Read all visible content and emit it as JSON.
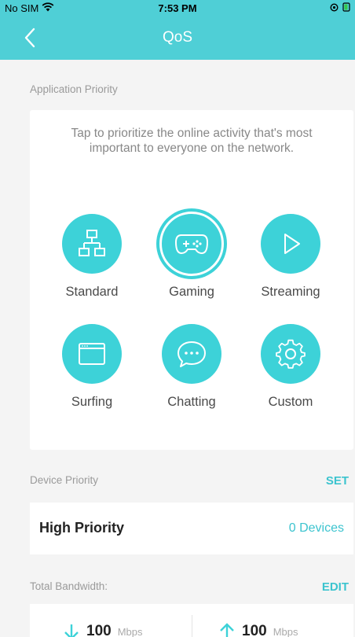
{
  "status_bar": {
    "carrier": "No SIM",
    "time": "7:53 PM"
  },
  "nav": {
    "title": "QoS"
  },
  "application_priority": {
    "section_label": "Application Priority",
    "description": "Tap to prioritize the online activity that's most important to everyone on the network.",
    "modes": [
      {
        "label": "Standard",
        "icon": "network-topology-icon",
        "selected": false
      },
      {
        "label": "Gaming",
        "icon": "gamepad-icon",
        "selected": true
      },
      {
        "label": "Streaming",
        "icon": "play-icon",
        "selected": false
      },
      {
        "label": "Surfing",
        "icon": "browser-window-icon",
        "selected": false
      },
      {
        "label": "Chatting",
        "icon": "chat-bubble-icon",
        "selected": false
      },
      {
        "label": "Custom",
        "icon": "gear-icon",
        "selected": false
      }
    ]
  },
  "device_priority": {
    "section_label": "Device Priority",
    "action_label": "SET",
    "row_title": "High Priority",
    "row_value": "0 Devices"
  },
  "total_bandwidth": {
    "section_label": "Total Bandwidth:",
    "action_label": "EDIT",
    "download": {
      "value": "100",
      "unit": "Mbps",
      "icon": "arrow-down-icon"
    },
    "upload": {
      "value": "100",
      "unit": "Mbps",
      "icon": "arrow-up-icon"
    }
  },
  "colors": {
    "accent": "#4fcfd6",
    "mode_circle": "#3dd2d8",
    "action_text": "#3cc4cf",
    "background": "#f4f4f4"
  }
}
